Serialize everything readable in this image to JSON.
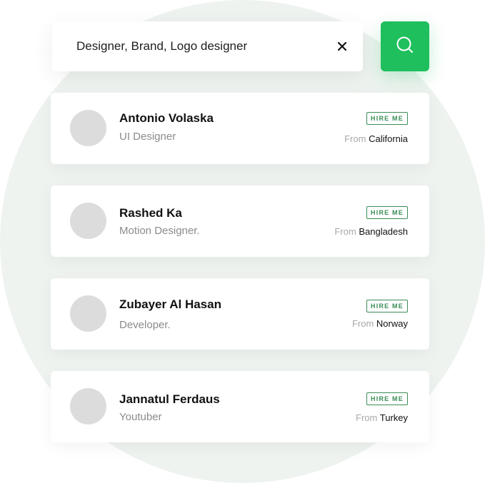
{
  "search": {
    "value": "Designer, Brand, Logo designer"
  },
  "icons": {
    "clear": "close-icon",
    "search": "search-icon"
  },
  "colors": {
    "accent": "#1fbf5d",
    "hire_border": "#3a8d57",
    "background_circle": "#eef3f0",
    "avatar": "#dcdcdc"
  },
  "results": [
    {
      "name": "Antonio Volaska",
      "role": "UI Designer",
      "hire_label": "HIRE ME",
      "from_label": "From",
      "location": "California"
    },
    {
      "name": "Rashed Ka",
      "role": "Motion Designer.",
      "hire_label": "HIRE ME",
      "from_label": "From",
      "location": "Bangladesh"
    },
    {
      "name": "Zubayer Al Hasan",
      "role": "Developer.",
      "hire_label": "HIRE ME",
      "from_label": "From",
      "location": "Norway"
    },
    {
      "name": "Jannatul Ferdaus",
      "role": "Youtuber",
      "hire_label": "HIRE ME",
      "from_label": "From",
      "location": "Turkey"
    }
  ]
}
